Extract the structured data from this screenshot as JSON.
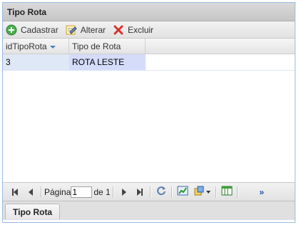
{
  "panel": {
    "title": "Tipo Rota"
  },
  "toolbar": {
    "cadastrar_label": "Cadastrar",
    "alterar_label": "Alterar",
    "excluir_label": "Excluir"
  },
  "grid": {
    "columns": [
      {
        "label": "idTipoRota",
        "sorted": "desc"
      },
      {
        "label": "Tipo de Rota"
      }
    ],
    "rows": [
      {
        "id": "3",
        "tipo": "ROTA LESTE"
      }
    ]
  },
  "pager": {
    "page_label": "Página",
    "page_value": "1",
    "of_label": "de 1"
  },
  "tabs": [
    {
      "label": "Tipo Rota"
    }
  ],
  "colors": {
    "selected_row": "#dfe8f6",
    "accent": "#4a7fc1"
  }
}
